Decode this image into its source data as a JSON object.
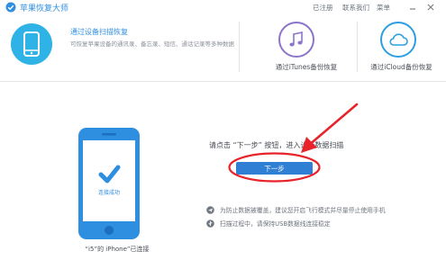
{
  "app": {
    "title": "苹果恢复大师",
    "register_label": "已注册",
    "contact_label": "联系我们",
    "menu_label": "菜单"
  },
  "modes": [
    {
      "title": "通过设备扫描恢复",
      "desc": "可恢复苹果设备的通讯录、备忘录、短信、通话记录等多种数据",
      "icon": "phone-icon",
      "active": true
    },
    {
      "title": "通过iTunes备份恢复",
      "icon": "music-note-icon"
    },
    {
      "title": "通过iCloud备份恢复",
      "icon": "cloud-icon"
    }
  ],
  "device": {
    "status": "连接成功",
    "caption": "“i5”的 iPhone”已连接"
  },
  "instruction": "请点击 “下一步” 按钮，进入设备数据扫描",
  "next_button": "下一步",
  "notes": [
    "为防止数据被覆盖，建议您开启飞行模式并尽量停止使用手机",
    "扫描过程中，请保持USB数据线连接稳定"
  ],
  "colors": {
    "accent": "#2f8fe0",
    "button": "#2f7fd4",
    "annotation": "#e8232a",
    "phone_frame": "#2e8ee0"
  }
}
